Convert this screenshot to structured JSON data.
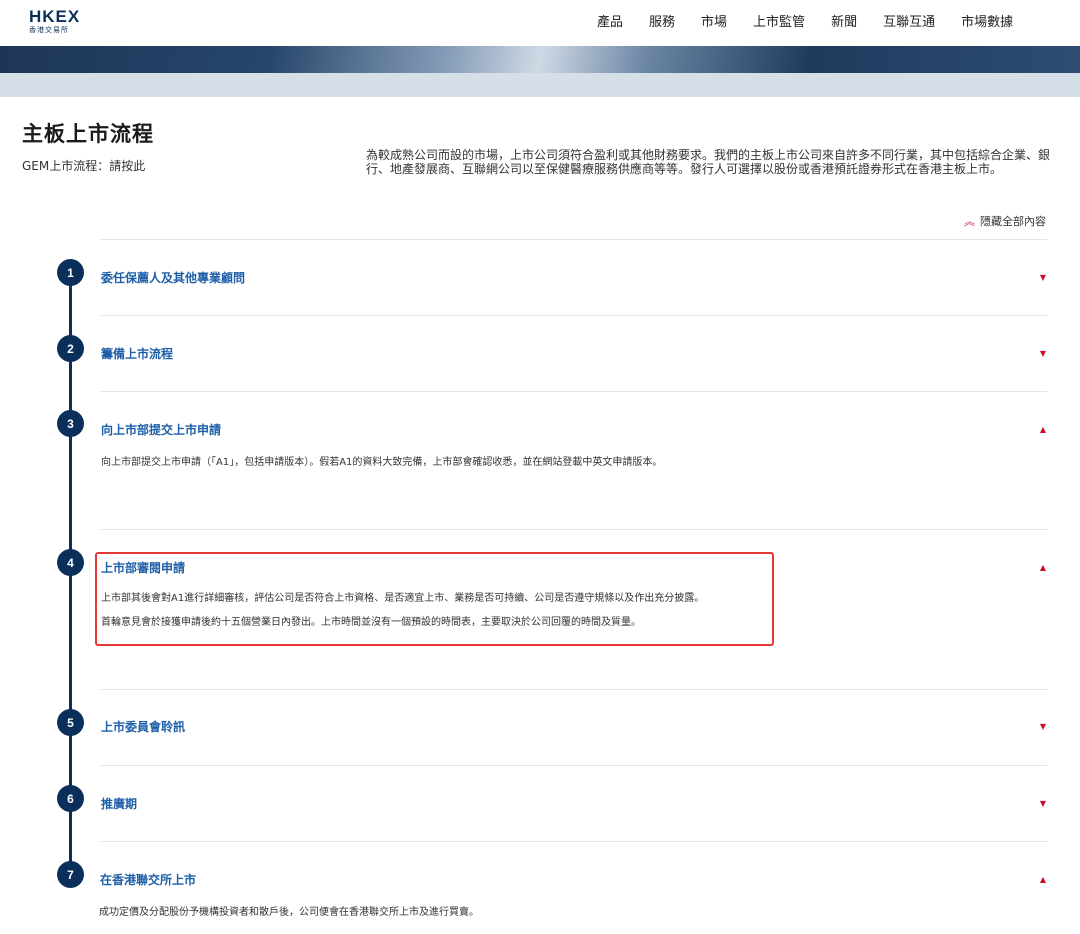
{
  "header": {
    "logo_main": "HKEX",
    "logo_sub": "香港交易所",
    "nav": [
      "產品",
      "服務",
      "市場",
      "上市監管",
      "新聞",
      "互聯互通",
      "市場數據"
    ]
  },
  "page": {
    "title": "主板上市流程",
    "gem_link": "GEM上市流程：請按此",
    "intro": "為較成熟公司而設的市場，上市公司須符合盈利或其他財務要求。我們的主板上市公司來自許多不同行業，其中包括綜合企業、銀行、地產發展商、互聯網公司以至保健醫療服務供應商等等。發行人可選擇以股份或香港預託證券形式在香港主板上市。",
    "hide_all": "隱藏全部內容"
  },
  "steps": [
    {
      "number": "1",
      "title": "委任保薦人及其他專業顧問",
      "expanded": false
    },
    {
      "number": "2",
      "title": "籌備上市流程",
      "expanded": false
    },
    {
      "number": "3",
      "title": "向上市部提交上市申請",
      "expanded": true,
      "body": [
        "向上市部提交上市申請（「A1」，包括申請版本）。假若A1的資料大致完備，上市部會確認收悉，並在網站登載中英文申請版本。"
      ]
    },
    {
      "number": "4",
      "title": "上市部審閱申請",
      "expanded": true,
      "body": [
        "上市部其後會對A1進行詳細審核，評估公司是否符合上市資格、是否適宜上市、業務是否可持續、公司是否遵守規條以及作出充分披露。",
        "首輪意見會於接獲申請後約十五個營業日內發出。上市時間並沒有一個預設的時間表，主要取決於公司回覆的時間及質量。"
      ]
    },
    {
      "number": "5",
      "title": "上市委員會聆訊",
      "expanded": false
    },
    {
      "number": "6",
      "title": "推廣期",
      "expanded": false
    },
    {
      "number": "7",
      "title": "在香港聯交所上市",
      "expanded": true,
      "body": [
        "成功定價及分配股份予機構投資者和散戶後，公司便會在香港聯交所上市及進行買賣。"
      ]
    }
  ],
  "colors": {
    "navy": "#0b2f5b",
    "link_blue": "#1f5fa8",
    "accent_red": "#c8102e",
    "highlight": "#e53935"
  },
  "icons": {
    "expanded": "caret-up-icon",
    "collapsed": "caret-down-icon",
    "hide_all": "double-chevron-up-icon"
  }
}
